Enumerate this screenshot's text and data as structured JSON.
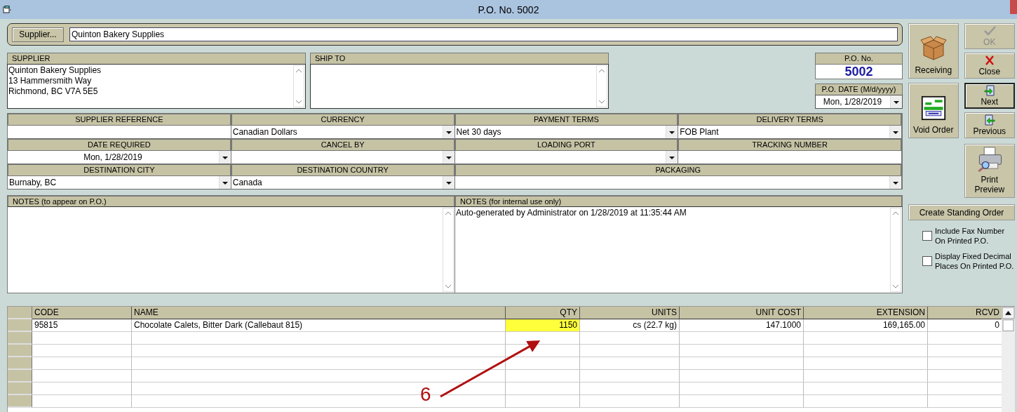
{
  "window": {
    "title": "P.O. No. 5002"
  },
  "supplier_bar": {
    "button": "Supplier...",
    "value": "Quinton Bakery Supplies"
  },
  "supplier": {
    "label": "SUPPLIER",
    "lines": [
      "Quinton Bakery Supplies",
      "13 Hammersmith Way",
      "Richmond, BC  V7A 5E5"
    ]
  },
  "ship_to": {
    "label": "SHIP TO"
  },
  "po_number": {
    "label": "P.O. No.",
    "value": "5002"
  },
  "po_date": {
    "label": "P.O. DATE (M/d/yyyy)",
    "value": "Mon, 1/28/2019"
  },
  "fields": [
    {
      "label": "SUPPLIER REFERENCE",
      "kind": "text",
      "wide": false
    },
    {
      "label": "CURRENCY",
      "kind": "dropdown",
      "value": "Canadian Dollars",
      "wide": false
    },
    {
      "label": "PAYMENT TERMS",
      "kind": "dropdown",
      "value": "Net 30 days",
      "wide": false
    },
    {
      "label": "DELIVERY TERMS",
      "kind": "dropdown",
      "value": "FOB Plant",
      "wide": false
    },
    {
      "label": "DATE REQUIRED",
      "kind": "date",
      "value": "Mon, 1/28/2019",
      "wide": false
    },
    {
      "label": "CANCEL BY",
      "kind": "dropdown",
      "wide": false
    },
    {
      "label": "LOADING PORT",
      "kind": "dropdown",
      "wide": false
    },
    {
      "label": "TRACKING NUMBER",
      "kind": "text",
      "wide": false
    },
    {
      "label": "DESTINATION CITY",
      "kind": "dropdown",
      "value": "Burnaby, BC",
      "wide": false
    },
    {
      "label": "DESTINATION COUNTRY",
      "kind": "dropdown",
      "value": "Canada",
      "wide": false
    },
    {
      "label": "PACKAGING",
      "kind": "dropdown",
      "wide": true
    }
  ],
  "notes": [
    {
      "label": "NOTES (to appear on P.O.)"
    },
    {
      "label": "NOTES (for internal use only)",
      "value": "Auto-generated by Administrator on 1/28/2019 at 11:35:44 AM"
    }
  ],
  "action_rows": [
    {
      "main": {
        "label": "Receiving",
        "kind": "box",
        "disabled": false,
        "default": false
      },
      "side": [
        {
          "label": "OK",
          "kind": "check",
          "disabled": true,
          "default": false
        },
        {
          "label": "Close",
          "kind": "x",
          "disabled": false,
          "default": false
        }
      ]
    },
    {
      "main": {
        "label": "Void Order",
        "kind": "void",
        "disabled": false,
        "default": false
      },
      "side": [
        {
          "label": "Next",
          "kind": "next",
          "disabled": false,
          "default": true
        },
        {
          "label": "Previous",
          "kind": "previous",
          "disabled": false,
          "default": false
        }
      ]
    },
    {
      "side": [
        {
          "label": "Print Preview",
          "kind": "printer",
          "disabled": false,
          "default": false
        }
      ]
    }
  ],
  "standing_order_button": "Create Standing Order",
  "options": [
    {
      "label": "Include Fax Number On Printed P.O.",
      "checked": false
    },
    {
      "label": "Display Fixed Decimal Places On Printed P.O.",
      "checked": false
    }
  ],
  "table": {
    "columns": [
      "CODE",
      "NAME",
      "QTY",
      "UNITS",
      "UNIT COST",
      "EXTENSION",
      "RCVD"
    ],
    "rows": [
      {
        "cells": [
          {
            "text": "95815",
            "highlighted": false
          },
          {
            "text": "Chocolate Calets, Bitter Dark (Callebaut 815)",
            "highlighted": false
          },
          {
            "text": "1150",
            "highlighted": true
          },
          {
            "text": "cs (22.7 kg)",
            "highlighted": false
          },
          {
            "text": "147.1000",
            "highlighted": false
          },
          {
            "text": "169,165.00",
            "highlighted": false
          },
          {
            "text": "0",
            "highlighted": false
          }
        ]
      }
    ]
  },
  "annotation": {
    "label": "6"
  }
}
